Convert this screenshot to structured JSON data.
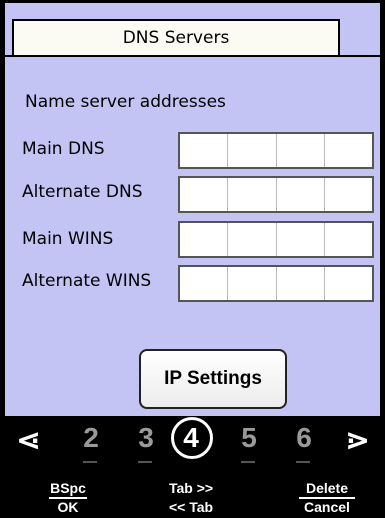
{
  "header": {
    "tab_label": "DNS Servers"
  },
  "form": {
    "section_label": "Name server addresses",
    "fields": [
      {
        "label": "Main DNS",
        "octets": [
          "",
          "",
          "",
          ""
        ]
      },
      {
        "label": "Alternate DNS",
        "octets": [
          "",
          "",
          "",
          ""
        ]
      },
      {
        "label": "Main WINS",
        "octets": [
          "",
          "",
          "",
          ""
        ]
      },
      {
        "label": "Alternate WINS",
        "octets": [
          "",
          "",
          "",
          ""
        ]
      }
    ],
    "ip_settings_label": "IP Settings"
  },
  "softbar": {
    "left_arrow": "⋖",
    "right_arrow": "⋗",
    "digits": [
      "2",
      "3",
      "4",
      "5",
      "6"
    ],
    "active_digit": "4",
    "keys": [
      {
        "top": "BSpc",
        "bottom": "OK"
      },
      {
        "top": "Tab >>",
        "bottom": "<< Tab"
      },
      {
        "top": "Delete",
        "bottom": "Cancel"
      }
    ]
  },
  "colors": {
    "background": "#c3c3f4",
    "tab": "#fbfbf3",
    "softbar": "#000000"
  }
}
